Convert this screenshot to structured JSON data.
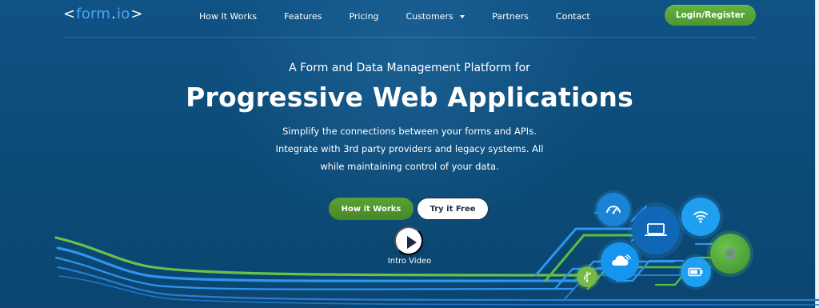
{
  "brand": {
    "left_bracket": "<",
    "name": "form",
    "dot": ".",
    "suffix": "io",
    "right_bracket": ">"
  },
  "nav": {
    "items": [
      {
        "label": "How It Works"
      },
      {
        "label": "Features"
      },
      {
        "label": "Pricing"
      },
      {
        "label": "Customers"
      },
      {
        "label": "Partners"
      },
      {
        "label": "Contact"
      }
    ],
    "login_label": "Login/Register"
  },
  "hero": {
    "kicker": "A Form and Data Management Platform for",
    "title": "Progressive Web Applications",
    "copy_lines": [
      "Simplify the connections between your forms and APIs.",
      "Integrate with 3rd party providers and legacy systems. All",
      "while maintaining control of your data."
    ],
    "primary_cta": "How it Works",
    "secondary_cta": "Try it Free",
    "video_label": "Intro Video"
  },
  "icons": {
    "menu_caret": "chevron-down-icon",
    "play": "play-icon",
    "speed": "speedometer-icon",
    "laptop": "laptop-icon",
    "wifi": "wifi-icon",
    "settings": "gear-icon",
    "cloud": "cloud-icon",
    "usb": "usb-icon",
    "battery": "battery-icon"
  },
  "colors": {
    "background": "#0d4d79",
    "accent_green": "#5aa235",
    "accent_blue": "#1f9ff0",
    "brand_blue": "#4ca4ff",
    "white": "#ffffff",
    "dark_text": "#1b2f45"
  }
}
